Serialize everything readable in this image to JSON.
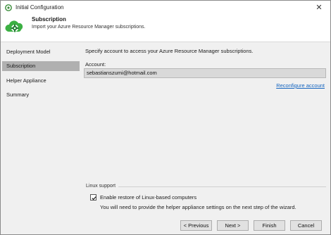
{
  "window": {
    "title": "Initial Configuration",
    "close_glyph": "✕"
  },
  "header": {
    "title": "Subscription",
    "subtitle": "Import your Azure Resource Manager subscriptions.",
    "icon": "cloud-gear-icon",
    "accent_color": "#3cb043"
  },
  "sidebar": {
    "items": [
      {
        "label": "Deployment Model",
        "active": false
      },
      {
        "label": "Subscription",
        "active": true
      },
      {
        "label": "Helper Appliance",
        "active": false
      },
      {
        "label": "Summary",
        "active": false
      }
    ]
  },
  "main": {
    "prompt": "Specify account to access your Azure Resource Manager subscriptions.",
    "account_label": "Account:",
    "account_value": "sebastianszumi@hotmail.com",
    "reconfigure_link": "Reconfigure account",
    "link_color": "#1565c0"
  },
  "linux": {
    "group_title": "Linux support",
    "checkbox_label": "Enable restore of Linux-based computers",
    "checked": true,
    "hint": "You will need to provide the helper appliance settings on the next step of the wizard."
  },
  "footer": {
    "previous": "< Previous",
    "next": "Next >",
    "finish": "Finish",
    "cancel": "Cancel"
  }
}
